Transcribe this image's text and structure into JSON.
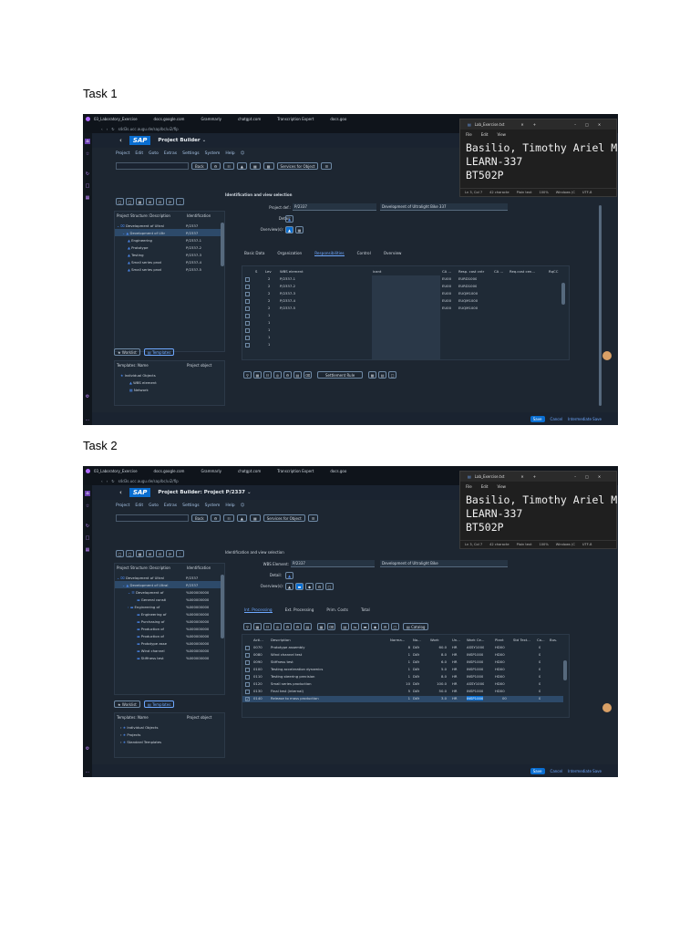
{
  "task1": {
    "title": "Task 1",
    "browser_tabs": [
      "03_Laboratory_Exercise",
      "docs.google.com",
      "Grammarly",
      "chatgpt.com",
      "Transcription Expert",
      "docs.goo"
    ],
    "address": "s4d3s.ucc.augu.de/sap/bc/ui2/flp",
    "sap": {
      "logo": "SAP",
      "app_title": "Project Builder",
      "menu": [
        "Project",
        "Edit",
        "Goto",
        "Extras",
        "Settings",
        "System",
        "Help"
      ],
      "toolbar_buttons": [
        "Back",
        "Services for Object"
      ],
      "tree_header_desc": "Project Structure: Description",
      "tree_header_ident": "Identification",
      "tree": [
        {
          "desc": "Development of Ultral",
          "ident": "P/2337"
        },
        {
          "desc": "Development of Ultr",
          "ident": "P/2337"
        },
        {
          "desc": "Engineering",
          "ident": "P/2337-1"
        },
        {
          "desc": "Prototype",
          "ident": "P/2337-2"
        },
        {
          "desc": "Testing",
          "ident": "P/2337-3"
        },
        {
          "desc": "Small series prod",
          "ident": "P/2337-4"
        },
        {
          "desc": "Small series prod",
          "ident": "P/2337-5"
        }
      ],
      "worklist_label": "Worklist",
      "templates_label": "Templates",
      "templates_header_name": "Templates: Name",
      "templates_header_obj": "Project object",
      "templates": [
        "Individual Objects",
        "WBS element",
        "Network"
      ],
      "section_title": "Identification and view selection",
      "project_def_label": "Project def.:",
      "project_def_value": "P/2337",
      "project_def_desc": "Development of Ultralight Bike 337",
      "detail_label": "Detail:",
      "overviews_label": "Overview(s):",
      "tabs": [
        "Basic Data",
        "Organization",
        "Responsibilities",
        "Control",
        "Overview"
      ],
      "active_tab": "Responsibilities",
      "columns": [
        "S",
        "Lev",
        "WBS element",
        "icant",
        "CA ...",
        "Resp. cost cntr",
        "CA ...",
        "Req.cost cen...",
        "RqCC"
      ],
      "rows": [
        {
          "lev": "2",
          "wbs": "P/2337-1",
          "ca": "EU00",
          "rcc": "EURD1000"
        },
        {
          "lev": "2",
          "wbs": "P/2337-2",
          "ca": "EU00",
          "rcc": "EURD1000"
        },
        {
          "lev": "2",
          "wbs": "P/2337-3",
          "ca": "EU00",
          "rcc": "EUQM1000"
        },
        {
          "lev": "2",
          "wbs": "P/2337-4",
          "ca": "EU00",
          "rcc": "EUQM1000"
        },
        {
          "lev": "2",
          "wbs": "P/2337-5",
          "ca": "EU00",
          "rcc": "EUQM1000"
        },
        {
          "lev": "1",
          "wbs": "",
          "ca": "",
          "rcc": ""
        },
        {
          "lev": "1",
          "wbs": "",
          "ca": "",
          "rcc": ""
        },
        {
          "lev": "1",
          "wbs": "",
          "ca": "",
          "rcc": ""
        },
        {
          "lev": "1",
          "wbs": "",
          "ca": "",
          "rcc": ""
        },
        {
          "lev": "1",
          "wbs": "",
          "ca": "",
          "rcc": ""
        }
      ],
      "settlement_rule": "Settlement Rule",
      "footer": {
        "save": "Save",
        "cancel": "Cancel",
        "intermediate": "Intermediate Save"
      }
    },
    "notepad": {
      "title": "Lab_Exercise.txt",
      "menu": [
        "File",
        "Edit",
        "View"
      ],
      "lines": [
        "Basilio, Timothy Ariel M.",
        "LEARN-337",
        "BT502P"
      ],
      "status": [
        "Ln 3, Col 7",
        "42 characte",
        "Plain text",
        "100%",
        "Windows (C",
        "UTF-8"
      ]
    }
  },
  "task2": {
    "title": "Task 2",
    "sap": {
      "app_title": "Project Builder: Project P/2337",
      "tree": [
        {
          "desc": "Development of Ultral",
          "ident": "P/2337"
        },
        {
          "desc": "Development of Ultral",
          "ident": "P/2337"
        },
        {
          "desc": "Development of",
          "ident": "%000000000"
        },
        {
          "desc": "General consti",
          "ident": "%000000000"
        },
        {
          "desc": "Engineering of",
          "ident": "%000000000"
        },
        {
          "desc": "Engineering of",
          "ident": "%000000000"
        },
        {
          "desc": "Purchasing of",
          "ident": "%000000000"
        },
        {
          "desc": "Production of",
          "ident": "%000000000"
        },
        {
          "desc": "Production of",
          "ident": "%000000000"
        },
        {
          "desc": "Prototype asse",
          "ident": "%000000000"
        },
        {
          "desc": "Wind channel",
          "ident": "%000000000"
        },
        {
          "desc": "Stiffness test",
          "ident": "%000000000"
        }
      ],
      "templates": [
        "Individual Objects",
        "Projects",
        "Standard Templates"
      ],
      "wbs_label": "WBS Element:",
      "wbs_value": "P/2337",
      "wbs_desc": "Development of Ultralight Bike",
      "tabs": [
        "Int. Processing",
        "Ext. Processing",
        "Prim. Costs",
        "Total"
      ],
      "active_tab": "Int. Processing",
      "catalog": "Catalog",
      "columns": [
        "Acti...",
        "Description",
        "Norma...",
        "No...",
        "Work",
        "Un...",
        "Work Ce...",
        "Plant",
        "Std Text...",
        "Ca...",
        "Bus."
      ],
      "rows": [
        {
          "act": "0070",
          "desc": "Prototype assembly",
          "norm": "8",
          "unit": "DAY",
          "work": "60.0",
          "un": "HR",
          "wc": "ASSY1000",
          "plant": "HD00",
          "ca": "0"
        },
        {
          "act": "0080",
          "desc": "Wind channel test",
          "norm": "1",
          "unit": "DAY",
          "work": "8.0",
          "un": "HR",
          "wc": "INSP1000",
          "plant": "HD00",
          "ca": "0"
        },
        {
          "act": "0090",
          "desc": "Stiffness test",
          "norm": "1",
          "unit": "DAY",
          "work": "6.0",
          "un": "HR",
          "wc": "INSP1000",
          "plant": "HD00",
          "ca": "0"
        },
        {
          "act": "0100",
          "desc": "Testing acceleration dynamics",
          "norm": "1",
          "unit": "DAY",
          "work": "5.0",
          "un": "HR",
          "wc": "INSP1000",
          "plant": "HD00",
          "ca": "0"
        },
        {
          "act": "0110",
          "desc": "Testing steering precision",
          "norm": "1",
          "unit": "DAY",
          "work": "8.0",
          "un": "HR",
          "wc": "INSP1000",
          "plant": "HD00",
          "ca": "0"
        },
        {
          "act": "0120",
          "desc": "Small series production",
          "norm": "10",
          "unit": "DAY",
          "work": "100.0",
          "un": "HR",
          "wc": "ASSY1000",
          "plant": "HD00",
          "ca": "0"
        },
        {
          "act": "0130",
          "desc": "Final test (internal)",
          "norm": "5",
          "unit": "DAY",
          "work": "50.0",
          "un": "HR",
          "wc": "INSP1000",
          "plant": "HD00",
          "ca": "0"
        },
        {
          "act": "0140",
          "desc": "Release to mass production",
          "norm": "1",
          "unit": "DAY",
          "work": "3.0",
          "un": "HR",
          "wc": "INSP1000",
          "plant": "00",
          "ca": "0"
        }
      ]
    }
  }
}
